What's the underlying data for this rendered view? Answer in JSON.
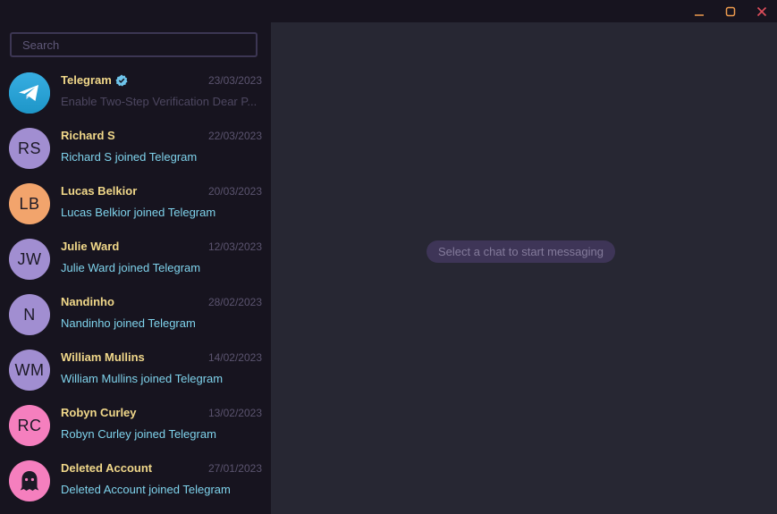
{
  "search": {
    "placeholder": "Search"
  },
  "window_controls": [
    "minimize-icon",
    "maximize-icon",
    "close-icon"
  ],
  "colors": {
    "sidebar_bg": "#17141f",
    "main_bg": "#272733",
    "name": "#f1d88a",
    "preview": "#7fd3ec",
    "close": "#e04e5b"
  },
  "chats": [
    {
      "name": "Telegram",
      "verified": true,
      "date": "23/03/2023",
      "preview": "Enable Two-Step Verification Dear P...",
      "avatar": "telegram-icon",
      "avatar_color": "#2aa4e0"
    },
    {
      "name": "Richard S",
      "date": "22/03/2023",
      "preview": "Richard S joined Telegram",
      "initials": "RS",
      "avatar_color": "#a18ed1"
    },
    {
      "name": "Lucas Belkior",
      "date": "20/03/2023",
      "preview": "Lucas Belkior joined Telegram",
      "initials": "LB",
      "avatar_color": "#f2a46c"
    },
    {
      "name": "Julie Ward",
      "date": "12/03/2023",
      "preview": "Julie Ward joined Telegram",
      "initials": "JW",
      "avatar_color": "#a18ed1"
    },
    {
      "name": "Nandinho",
      "date": "28/02/2023",
      "preview": "Nandinho joined Telegram",
      "initials": "N",
      "avatar_color": "#a18ed1"
    },
    {
      "name": "William Mullins",
      "date": "14/02/2023",
      "preview": "William Mullins joined Telegram",
      "initials": "WM",
      "avatar_color": "#a18ed1"
    },
    {
      "name": "Robyn Curley",
      "date": "13/02/2023",
      "preview": "Robyn Curley joined Telegram",
      "initials": "RC",
      "avatar_color": "#f57fbe"
    },
    {
      "name": "Deleted Account",
      "date": "27/01/2023",
      "preview": "Deleted Account joined Telegram",
      "avatar": "ghost-icon",
      "avatar_color": "#f57fbe"
    }
  ],
  "main": {
    "empty_message": "Select a chat to start messaging"
  }
}
